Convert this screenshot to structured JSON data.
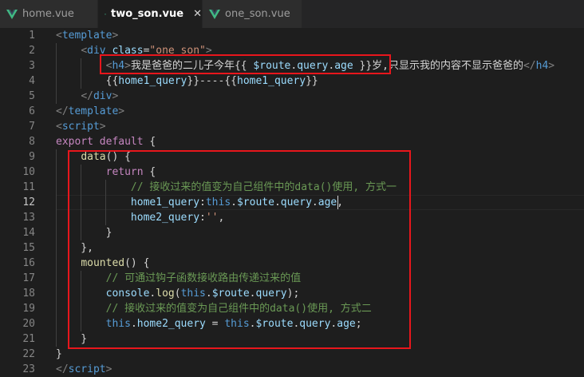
{
  "tabs": [
    {
      "label": "home.vue",
      "active": false
    },
    {
      "label": "two_son.vue",
      "active": true,
      "close": "✕"
    },
    {
      "label": "one_son.vue",
      "active": false
    }
  ],
  "colors": {
    "tag": "#569cd6",
    "attr": "#9cdcfe",
    "string": "#ce9178",
    "keyword": "#c586c0",
    "func": "#dcdcaa",
    "comment": "#6a9955",
    "plain": "#d4d4d4",
    "this": "#569cd6",
    "bracket": "#808080",
    "highlight_box": "#e8161c",
    "vue_icon": "#41b883"
  },
  "icons": {
    "tab_icon": "vue-logo-icon",
    "close": "close-icon"
  },
  "current_line": 12,
  "lines": [
    {
      "n": "1",
      "tokens": [
        [
          "t",
          "<"
        ],
        [
          "k",
          "template"
        ],
        [
          "t",
          ">"
        ]
      ]
    },
    {
      "n": "2",
      "tokens": [
        [
          "p",
          "    "
        ],
        [
          "t",
          "<"
        ],
        [
          "k",
          "div"
        ],
        [
          "p",
          " "
        ],
        [
          "a",
          "class"
        ],
        [
          "p",
          "="
        ],
        [
          "s",
          "\"one_son\""
        ],
        [
          "t",
          ">"
        ]
      ]
    },
    {
      "n": "3",
      "tokens": [
        [
          "p",
          "        "
        ],
        [
          "t",
          "<"
        ],
        [
          "k",
          "h4"
        ],
        [
          "t",
          ">"
        ],
        [
          "p",
          "我是爸爸的二儿子今年{{ "
        ],
        [
          "a",
          "$route"
        ],
        [
          "p",
          "."
        ],
        [
          "a",
          "query"
        ],
        [
          "p",
          "."
        ],
        [
          "a",
          "age"
        ],
        [
          "p",
          " }}岁,只显示我的内容不显示爸爸的"
        ],
        [
          "t",
          "</"
        ],
        [
          "k",
          "h4"
        ],
        [
          "t",
          ">"
        ]
      ]
    },
    {
      "n": "4",
      "tokens": [
        [
          "p",
          "        {{"
        ],
        [
          "a",
          "home1_query"
        ],
        [
          "p",
          "}}----{{"
        ],
        [
          "a",
          "home1_query"
        ],
        [
          "p",
          "}}"
        ]
      ]
    },
    {
      "n": "5",
      "tokens": [
        [
          "p",
          "    "
        ],
        [
          "t",
          "</"
        ],
        [
          "k",
          "div"
        ],
        [
          "t",
          ">"
        ]
      ]
    },
    {
      "n": "6",
      "tokens": [
        [
          "t",
          "</"
        ],
        [
          "k",
          "template"
        ],
        [
          "t",
          ">"
        ]
      ]
    },
    {
      "n": "7",
      "tokens": [
        [
          "t",
          "<"
        ],
        [
          "k",
          "script"
        ],
        [
          "t",
          ">"
        ]
      ]
    },
    {
      "n": "8",
      "tokens": [
        [
          "kw",
          "export"
        ],
        [
          "p",
          " "
        ],
        [
          "kw",
          "default"
        ],
        [
          "p",
          " {"
        ]
      ]
    },
    {
      "n": "9",
      "tokens": [
        [
          "p",
          "    "
        ],
        [
          "f",
          "data"
        ],
        [
          "p",
          "() {"
        ]
      ]
    },
    {
      "n": "10",
      "tokens": [
        [
          "p",
          "        "
        ],
        [
          "kw",
          "return"
        ],
        [
          "p",
          " {"
        ]
      ]
    },
    {
      "n": "11",
      "tokens": [
        [
          "p",
          "            "
        ],
        [
          "c",
          "// 接收过来的值变为自己组件中的data()使用, 方式一"
        ]
      ]
    },
    {
      "n": "12",
      "tokens": [
        [
          "p",
          "            "
        ],
        [
          "a",
          "home1_query"
        ],
        [
          "p",
          ":"
        ],
        [
          "th",
          "this"
        ],
        [
          "p",
          "."
        ],
        [
          "a",
          "$route"
        ],
        [
          "p",
          "."
        ],
        [
          "a",
          "query"
        ],
        [
          "p",
          "."
        ],
        [
          "a",
          "age"
        ],
        [
          "p",
          ","
        ]
      ]
    },
    {
      "n": "13",
      "tokens": [
        [
          "p",
          "            "
        ],
        [
          "a",
          "home2_query"
        ],
        [
          "p",
          ":"
        ],
        [
          "s",
          "''"
        ],
        [
          "p",
          ","
        ]
      ]
    },
    {
      "n": "14",
      "tokens": [
        [
          "p",
          "        }"
        ]
      ]
    },
    {
      "n": "15",
      "tokens": [
        [
          "p",
          "    },"
        ]
      ]
    },
    {
      "n": "16",
      "tokens": [
        [
          "p",
          "    "
        ],
        [
          "f",
          "mounted"
        ],
        [
          "p",
          "() {"
        ]
      ]
    },
    {
      "n": "17",
      "tokens": [
        [
          "p",
          "        "
        ],
        [
          "c",
          "// 可通过钩子函数接收路由传递过来的值"
        ]
      ]
    },
    {
      "n": "18",
      "tokens": [
        [
          "p",
          "        "
        ],
        [
          "a",
          "console"
        ],
        [
          "p",
          "."
        ],
        [
          "f",
          "log"
        ],
        [
          "p",
          "("
        ],
        [
          "th",
          "this"
        ],
        [
          "p",
          "."
        ],
        [
          "a",
          "$route"
        ],
        [
          "p",
          "."
        ],
        [
          "a",
          "query"
        ],
        [
          "p",
          ");"
        ]
      ]
    },
    {
      "n": "19",
      "tokens": [
        [
          "p",
          "        "
        ],
        [
          "c",
          "// 接收过来的值变为自己组件中的data()使用, 方式二"
        ]
      ]
    },
    {
      "n": "20",
      "tokens": [
        [
          "p",
          "        "
        ],
        [
          "th",
          "this"
        ],
        [
          "p",
          "."
        ],
        [
          "a",
          "home2_query"
        ],
        [
          "p",
          " = "
        ],
        [
          "th",
          "this"
        ],
        [
          "p",
          "."
        ],
        [
          "a",
          "$route"
        ],
        [
          "p",
          "."
        ],
        [
          "a",
          "query"
        ],
        [
          "p",
          "."
        ],
        [
          "a",
          "age"
        ],
        [
          "p",
          ";"
        ]
      ]
    },
    {
      "n": "21",
      "tokens": [
        [
          "p",
          "    }"
        ]
      ]
    },
    {
      "n": "22",
      "tokens": [
        [
          "p",
          "}"
        ]
      ]
    },
    {
      "n": "23",
      "tokens": [
        [
          "t",
          "</"
        ],
        [
          "k",
          "script"
        ],
        [
          "t",
          ">"
        ]
      ]
    }
  ]
}
